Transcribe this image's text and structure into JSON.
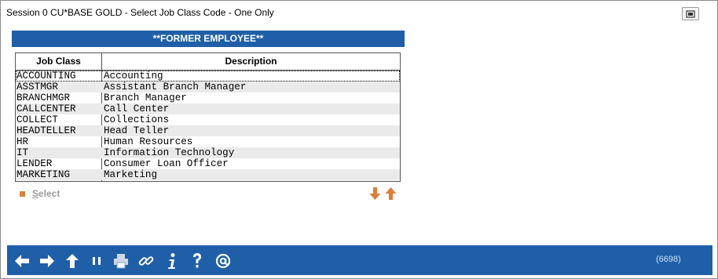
{
  "window": {
    "title": "Session 0 CU*BASE GOLD - Select Job Class Code - One Only"
  },
  "banner": "**FORMER EMPLOYEE**",
  "grid": {
    "columns": [
      "Job Class",
      "Description"
    ],
    "rows": [
      {
        "code": "ACCOUNTING",
        "desc": "Accounting"
      },
      {
        "code": "ASSTMGR",
        "desc": "Assistant Branch Manager"
      },
      {
        "code": "BRANCHMGR",
        "desc": "Branch Manager"
      },
      {
        "code": "CALLCENTER",
        "desc": "Call Center"
      },
      {
        "code": "COLLECT",
        "desc": "Collections"
      },
      {
        "code": "HEADTELLER",
        "desc": "Head Teller"
      },
      {
        "code": "HR",
        "desc": "Human Resources"
      },
      {
        "code": "IT",
        "desc": "Information Technology"
      },
      {
        "code": "LENDER",
        "desc": "Consumer Loan Officer"
      },
      {
        "code": "MARKETING",
        "desc": "Marketing"
      }
    ]
  },
  "options": {
    "select_label_first": "S",
    "select_label_rest": "elect"
  },
  "footer": {
    "screen_id": "(6698)",
    "icons": [
      "back-arrow-icon",
      "forward-arrow-icon",
      "up-arrow-icon",
      "pause-icon",
      "print-icon",
      "link-icon",
      "info-icon",
      "help-icon",
      "email-icon"
    ]
  },
  "colors": {
    "brand_blue": "#1f5fa8",
    "accent_orange": "#d9803a"
  }
}
